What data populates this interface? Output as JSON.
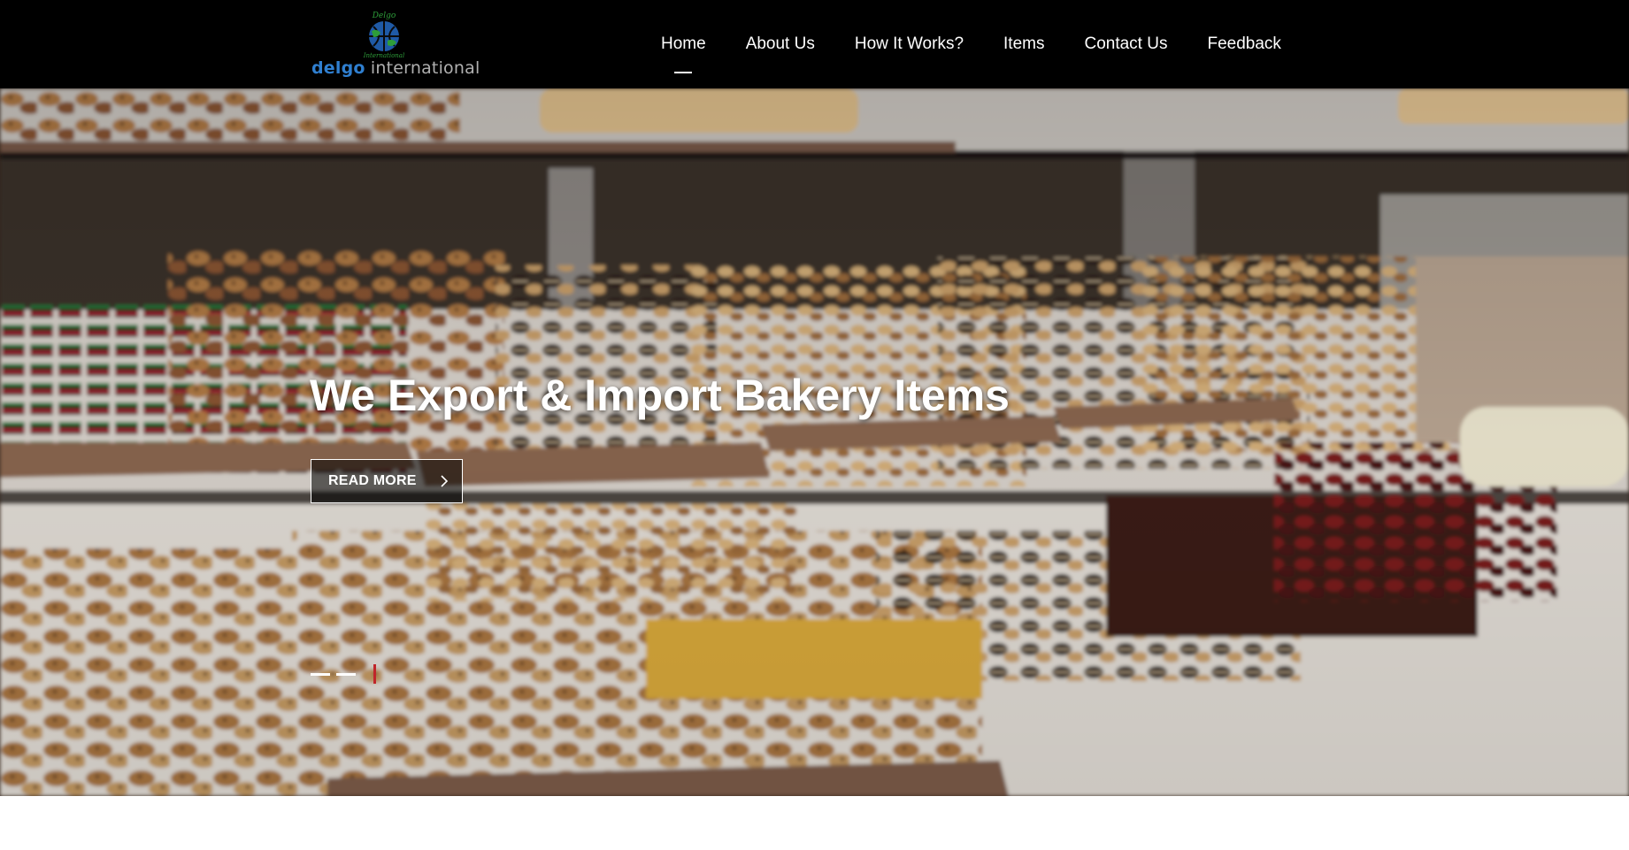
{
  "header": {
    "logo": {
      "arc_text": "Delgo",
      "banner_text": "International",
      "wordmark_part1": "delgo",
      "wordmark_part2": "international"
    },
    "nav": [
      {
        "label": "Home",
        "active": true
      },
      {
        "label": "About Us",
        "active": false
      },
      {
        "label": "How It Works?",
        "active": false
      },
      {
        "label": "Items",
        "active": false
      },
      {
        "label": "Contact Us",
        "active": false
      },
      {
        "label": "Feedback",
        "active": false
      }
    ]
  },
  "hero": {
    "title": "We Export & Import Bakery Items",
    "button_label": "READ MORE",
    "button_icon": "chevron-right-icon",
    "slides": [
      {
        "active": false
      },
      {
        "active": false
      },
      {
        "active": true
      }
    ]
  },
  "colors": {
    "nav_background": "#000000",
    "accent_red": "#c0252a",
    "logo_blue": "#2f7fd0",
    "logo_green": "#2e9e3a"
  }
}
